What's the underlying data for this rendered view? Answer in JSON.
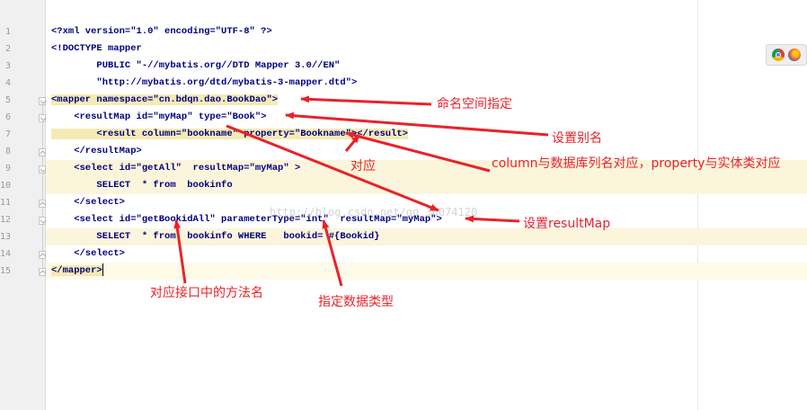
{
  "editor": {
    "line_numbers": [
      "1",
      "2",
      "3",
      "4",
      "5",
      "6",
      "7",
      "8",
      "9",
      "10",
      "11",
      "12",
      "13",
      "14",
      "15"
    ],
    "lines": [
      "<?xml version=\"1.0\" encoding=\"UTF-8\" ?>",
      "<!DOCTYPE mapper",
      "        PUBLIC \"-//mybatis.org//DTD Mapper 3.0//EN\"",
      "        \"http://mybatis.org/dtd/mybatis-3-mapper.dtd\">",
      "<mapper namespace=\"cn.bdqn.dao.BookDao\">",
      "    <resultMap id=\"myMap\" type=\"Book\">",
      "        <result column=\"bookname\" property=\"Bookname\"></result>",
      "    </resultMap>",
      "    <select id=\"getAll\"  resultMap=\"myMap\" >",
      "        SELECT  * from  bookinfo",
      "    </select>",
      "    <select id=\"getBookidAll\" parameterType=\"int\"  resultMap=\"myMap\">",
      "        SELECT  * from  bookinfo WHERE   bookid= #{Bookid}",
      "    </select>",
      "</mapper>"
    ]
  },
  "annotations": {
    "namespace": "命名空间指定",
    "alias": "设置别名",
    "mapping": "对应",
    "column_property": "column与数据库列名对应，property与实体类对应",
    "set_resultmap": "设置resultMap",
    "method_name": "对应接口中的方法名",
    "param_type": "指定数据类型"
  },
  "watermark": "http://blog.csdn.net/qq_36074120",
  "colors": {
    "annotation": "#e8232a",
    "tag": "#000080",
    "value": "#008000",
    "tag_highlight": "#f5eab6",
    "line_highlight": "#fbf5dc"
  },
  "toolbar": {
    "browser_icons": [
      "chrome-icon",
      "firefox-icon"
    ]
  }
}
